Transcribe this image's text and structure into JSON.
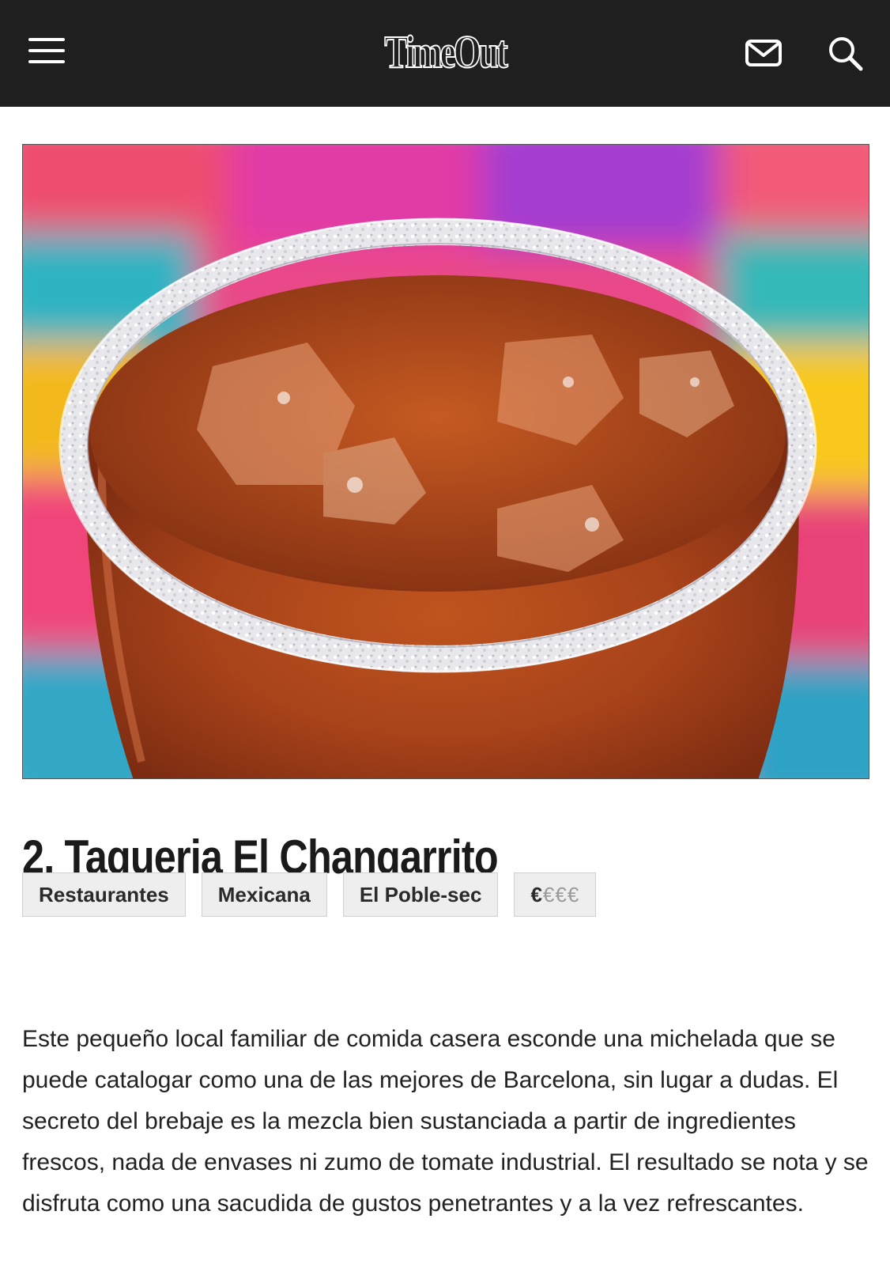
{
  "header": {
    "logo_text": "TimeOut",
    "menu_icon": "hamburger-menu-icon",
    "mail_icon": "envelope-icon",
    "search_icon": "magnifier-icon",
    "colors": {
      "background": "#1f1f1f",
      "foreground": "#ffffff"
    }
  },
  "hero_image": {
    "subject": "michelada-glass-photo"
  },
  "article": {
    "title": "2. Taqueria El Changarrito",
    "tags": [
      "Restaurantes",
      "Mexicana",
      "El Poble-sec"
    ],
    "price": {
      "active": "€",
      "inactive": "€€€"
    },
    "description": "Este pequeño local familiar de comida casera esconde una michelada que se puede catalogar como una de las mejores de Barcelona, sin lugar a dudas. El secreto del brebaje es la mezcla bien sustanciada a partir de ingredientes frescos, nada de envases ni zumo de tomate industrial. El resultado se nota y se disfruta como una sacudida de gustos penetrantes y a la vez refrescantes."
  }
}
